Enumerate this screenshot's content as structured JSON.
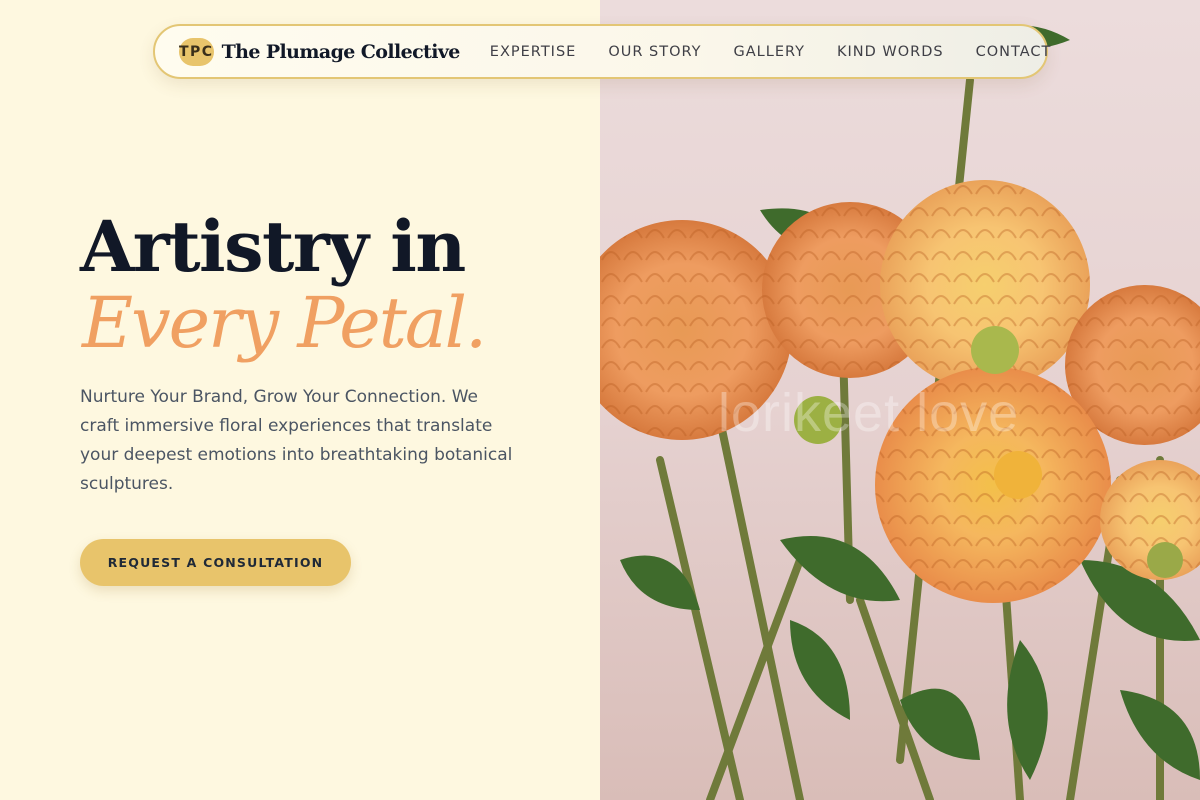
{
  "nav": {
    "badge": "TPC",
    "brand": "The Plumage Collective",
    "links": [
      "EXPERTISE",
      "OUR STORY",
      "GALLERY",
      "KIND WORDS",
      "CONTACT"
    ]
  },
  "hero": {
    "line1": "Artistry in",
    "line2": "Every Petal.",
    "description": "Nurture Your Brand, Grow Your Connection. We craft immersive floral experiences that translate your deepest emotions into breathtaking botanical sculptures.",
    "cta": "REQUEST A CONSULTATION"
  },
  "image": {
    "watermark": "lorikeet love"
  },
  "colors": {
    "accent_gold": "#e8c46b",
    "accent_peach": "#f0a062",
    "background_cream": "#fef8e0",
    "heading": "#111827"
  }
}
